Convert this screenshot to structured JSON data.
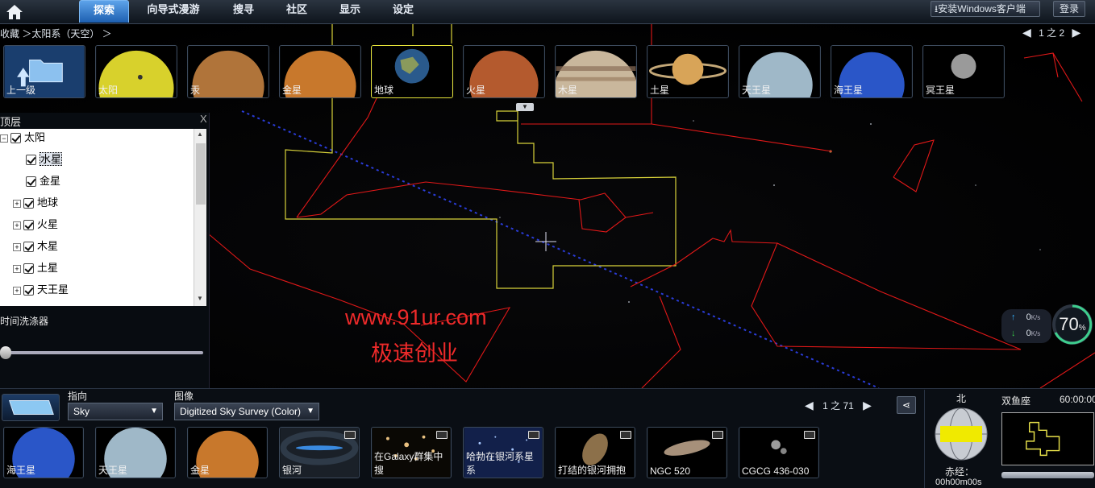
{
  "menu": {
    "tabs": [
      {
        "label": "探索",
        "active": true
      },
      {
        "label": "向导式漫游",
        "active": false
      },
      {
        "label": "搜寻",
        "active": false
      },
      {
        "label": "社区",
        "active": false
      },
      {
        "label": "显示",
        "active": false
      },
      {
        "label": "设定",
        "active": false
      }
    ],
    "install_label": "安装Windows客户端",
    "login_label": "登录"
  },
  "breadcrumb": {
    "text": "收藏 ＞太阳系（天空） ＞"
  },
  "top_pager": {
    "text": "1 之 2"
  },
  "top_thumbs": [
    {
      "label": "上一级"
    },
    {
      "label": "太阳"
    },
    {
      "label": "汞"
    },
    {
      "label": "金星"
    },
    {
      "label": "地球",
      "selected": true
    },
    {
      "label": "火星"
    },
    {
      "label": "木星"
    },
    {
      "label": "土星"
    },
    {
      "label": "天王星"
    },
    {
      "label": "海王星"
    },
    {
      "label": "冥王星"
    }
  ],
  "layers": {
    "title": "顶层",
    "close": "X",
    "items": [
      {
        "label": "太阳",
        "expander": "⊟"
      },
      {
        "label": "水星"
      },
      {
        "label": "金星"
      },
      {
        "label": "地球",
        "expander": "⊞"
      },
      {
        "label": "火星",
        "expander": "⊞"
      },
      {
        "label": "木星",
        "expander": "⊞"
      },
      {
        "label": "土星",
        "expander": "⊞"
      },
      {
        "label": "天王星",
        "expander": "⊞"
      }
    ],
    "time_scrubber_label": "时间洗涤器"
  },
  "watermark": {
    "url": "www.91ur.com",
    "text": "极速创业"
  },
  "speed": {
    "up": "0",
    "down": "0",
    "unit": "K/s",
    "percent": "70",
    "percent_sign": "%"
  },
  "bottom": {
    "look_at_label": "指向",
    "look_at_value": "Sky",
    "imagery_label": "图像",
    "imagery_value": "Digitized Sky Survey (Color)",
    "pager": "1 之 71",
    "thumbs": [
      {
        "label": "海王星"
      },
      {
        "label": "天王星"
      },
      {
        "label": "金星"
      },
      {
        "label": "银河"
      },
      {
        "label": "在Galaxy群集中搜"
      },
      {
        "label": "哈勃在银河系星系"
      },
      {
        "label": "打结的银河拥抱"
      },
      {
        "label": "NGC 520"
      },
      {
        "label": "CGCG 436-030"
      }
    ],
    "compass_north": "北",
    "ra_label": "赤经：",
    "ra_value": "00h00m00s",
    "constellation": "双鱼座",
    "fov": "60:00:00"
  },
  "colors": {
    "accent": "#2f7fd6",
    "constellation_line": "#e01818",
    "boundary_line": "#d8d23a",
    "ecliptic": "#2a3cd8",
    "selected_border": "#e6e33a"
  }
}
